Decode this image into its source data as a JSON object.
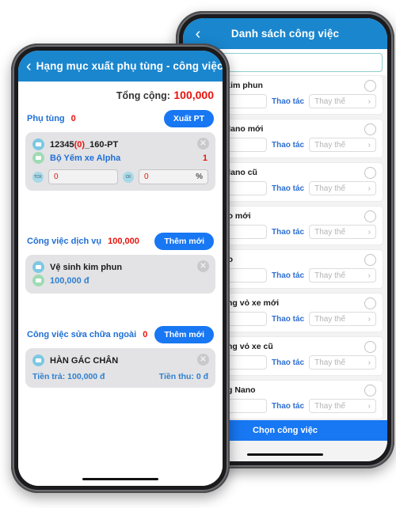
{
  "back_phone": {
    "header": {
      "back_icon": "chevron-left-icon",
      "title": "Danh sách công việc"
    },
    "search": {
      "value": "",
      "placeholder": ""
    },
    "jobs": [
      {
        "name": "Vệ sinh kim phun",
        "price": "",
        "action_label": "Thao tác",
        "select_placeholder": "Thay thế"
      },
      {
        "name": "Rửa xe Nano mới",
        "price": "",
        "action_label": "Thao tác",
        "select_placeholder": "Thay thế"
      },
      {
        "name": "Rửa xe Nano cũ",
        "price": "",
        "action_label": "Thao tác",
        "select_placeholder": "Thay thế"
      },
      {
        "name": "Phủ Nano mới",
        "price": "",
        "action_label": "Thao tác",
        "select_placeholder": "Thay thế"
      },
      {
        "name": "Phủ Nano",
        "price": "",
        "action_label": "Thao tác",
        "select_placeholder": "Thay thế"
      },
      {
        "name": "Đánh bóng vỏ xe mới",
        "price": "",
        "action_label": "Thao tác",
        "select_placeholder": "Thay thế"
      },
      {
        "name": "Đánh bóng vỏ xe cũ",
        "price": "",
        "action_label": "Thao tác",
        "select_placeholder": "Thay thế"
      },
      {
        "name": "Phủ bóng Nano",
        "price": "",
        "action_label": "Thao tác",
        "select_placeholder": "Thay thế"
      }
    ],
    "choose_button": "Chọn công việc"
  },
  "front_phone": {
    "header": {
      "back_icon": "chevron-left-icon",
      "title": "Hạng mục xuất phụ tùng - công việc"
    },
    "total": {
      "label": "Tổng cộng:",
      "value": "100,000"
    },
    "parts_section": {
      "title": "Phụ tùng",
      "count": "0",
      "button": "Xuất PT",
      "item": {
        "code": "12345",
        "code_paren": "(0)",
        "code_suffix": "_160-PT",
        "name": "Bộ Yếm xe Alpha",
        "qty": "1",
        "close_icon": "close-icon",
        "tck": {
          "label": "TCK",
          "value": "0"
        },
        "ck": {
          "label": "CK",
          "value": "0",
          "suffix": "%"
        }
      }
    },
    "service_section": {
      "title": "Công việc dịch vụ",
      "count": "100,000",
      "button": "Thêm mới",
      "item": {
        "name": "Vệ sinh kim phun",
        "amount": "100,000 đ",
        "close_icon": "close-icon"
      }
    },
    "external_section": {
      "title": "Công việc sửa chữa ngoài",
      "count": "0",
      "button": "Thêm mới",
      "item": {
        "name": "HÀN GÁC CHÂN",
        "paid_label": "Tiền trả: 100,000 đ",
        "received_label": "Tiền thu: 0 đ",
        "close_icon": "close-icon"
      }
    }
  }
}
